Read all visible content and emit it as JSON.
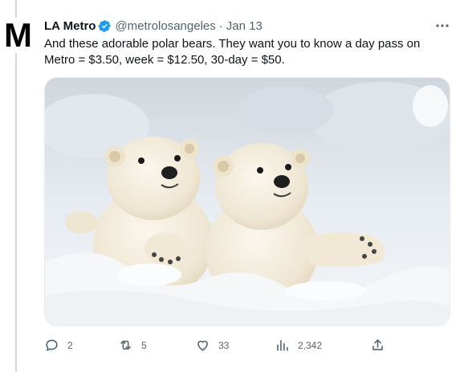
{
  "tweet": {
    "avatar_glyph": "M",
    "author_name": "LA Metro",
    "author_handle": "@metrolosangeles",
    "separator": "·",
    "timestamp": "Jan 13",
    "text": "And these adorable polar bears. They want you to know a day pass on Metro = $3.50, week = $12.50, 30-day = $50.",
    "verified_color": "#1d9bf0",
    "media_icon": "photo-two-polar-bear-cubs-in-snow"
  },
  "actions": {
    "reply_count": "2",
    "retweet_count": "5",
    "like_count": "33",
    "views_count": "2,342"
  },
  "icons": [
    "verified-badge-icon",
    "more-icon",
    "reply-icon",
    "retweet-icon",
    "like-icon",
    "views-icon",
    "share-icon"
  ]
}
